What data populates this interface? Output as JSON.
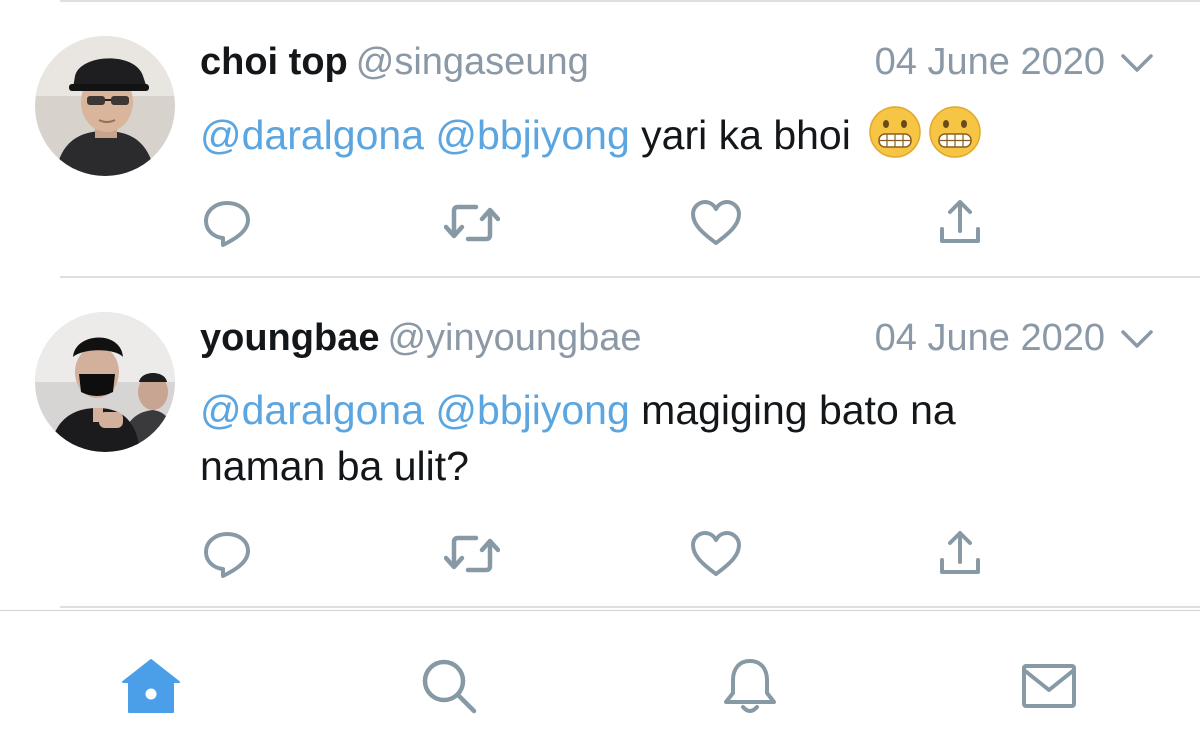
{
  "tweets": [
    {
      "name": "choi top",
      "handle": "@singaseung",
      "date": "04 June 2020",
      "mention1": "@daralgona",
      "mention2": "@bbjiyong",
      "text": "yari ka bhoi",
      "emojis": [
        "grimacing-face",
        "grimacing-face"
      ]
    },
    {
      "name": "youngbae",
      "handle": "@yinyoungbae",
      "date": "04 June 2020",
      "mention1": "@daralgona",
      "mention2": "@bbjiyong",
      "text": "magiging bato na naman ba ulit?"
    }
  ],
  "actions": [
    "reply-icon",
    "retweet-icon",
    "like-icon",
    "share-icon"
  ],
  "tabbar": {
    "active": "home",
    "tabs": [
      "home-icon",
      "search-icon",
      "notifications-icon",
      "messages-icon"
    ]
  },
  "colors": {
    "accent": "#4a9fe8",
    "mention": "#5ba6e0",
    "meta": "#8b98a5",
    "icon": "#8899a6",
    "text": "#14171a"
  }
}
